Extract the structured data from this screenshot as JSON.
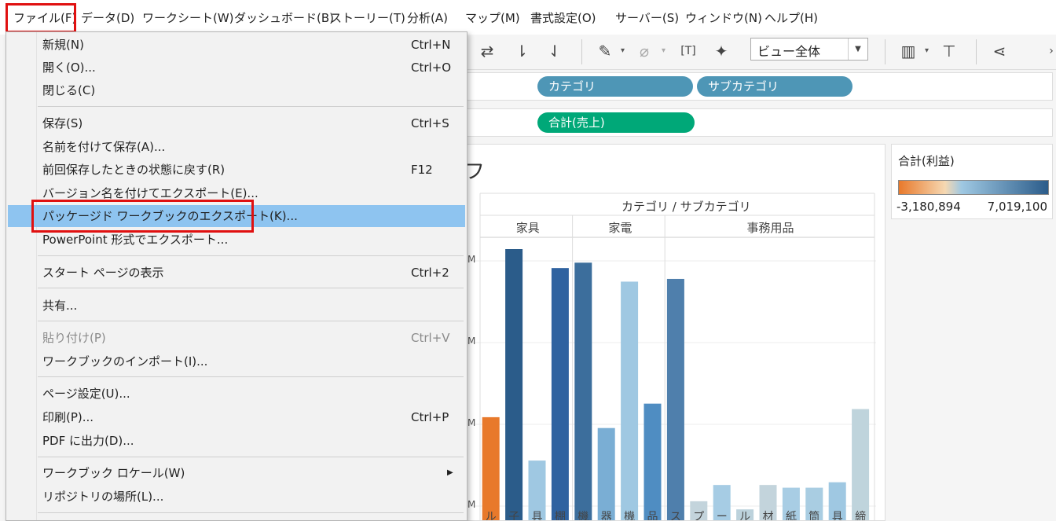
{
  "menubar": {
    "items": [
      {
        "label": "ファイル(F)",
        "name": "menu-file"
      },
      {
        "label": "データ(D)",
        "name": "menu-data"
      },
      {
        "label": "ワークシート(W)",
        "name": "menu-worksheet"
      },
      {
        "label": "ダッシュボード(B)",
        "name": "menu-dashboard"
      },
      {
        "label": "ストーリー(T)",
        "name": "menu-story"
      },
      {
        "label": "分析(A)",
        "name": "menu-analysis"
      },
      {
        "label": "マップ(M)",
        "name": "menu-map"
      },
      {
        "label": "書式設定(O)",
        "name": "menu-format"
      },
      {
        "label": "サーバー(S)",
        "name": "menu-server"
      },
      {
        "label": "ウィンドウ(N)",
        "name": "menu-window"
      },
      {
        "label": "ヘルプ(H)",
        "name": "menu-help"
      }
    ]
  },
  "toolbar": {
    "view_select": "ビュー全体",
    "icons": [
      "swap-icon",
      "sort-ascending-icon",
      "sort-descending-icon",
      "highlight-pen-icon",
      "paperclip-icon",
      "text-label-icon",
      "pin-icon",
      "show-me-icon",
      "presentation-icon",
      "share-icon",
      "more-chevron-icon"
    ]
  },
  "shelves": {
    "columns": [
      {
        "label": "カテゴリ",
        "color": "#4e96b6"
      },
      {
        "label": "サブカテゴリ",
        "color": "#4e96b6"
      }
    ],
    "rows": [
      {
        "label": "合計(売上)",
        "color": "#00a878"
      }
    ]
  },
  "view": {
    "title_fragment": "フ",
    "header": "カテゴリ / サブカテゴリ"
  },
  "legend": {
    "title": "合計(利益)",
    "min": "-3,180,894",
    "max": "7,019,100",
    "colors": [
      "#e8792b",
      "#f6d8b2",
      "#9fc8e2",
      "#2b5c8a"
    ]
  },
  "chart_data": {
    "type": "bar",
    "categories": [
      "家具",
      "家電",
      "事務用品"
    ],
    "bars": [
      {
        "category": "家具",
        "value": 38,
        "color": "#e8792b",
        "tick": "ル"
      },
      {
        "category": "家具",
        "value": 100,
        "color": "#2b5c8a",
        "tick": "子"
      },
      {
        "category": "家具",
        "value": 22,
        "color": "#9fc8e2",
        "tick": "具"
      },
      {
        "category": "家具",
        "value": 93,
        "color": "#2f62a0",
        "tick": "棚"
      },
      {
        "category": "家電",
        "value": 95,
        "color": "#3c6e9c",
        "tick": "機"
      },
      {
        "category": "家電",
        "value": 34,
        "color": "#7aaed4",
        "tick": "器"
      },
      {
        "category": "家電",
        "value": 88,
        "color": "#9fc8e2",
        "tick": "機"
      },
      {
        "category": "家電",
        "value": 43,
        "color": "#4f8dc2",
        "tick": "品"
      },
      {
        "category": "事務用品",
        "value": 89,
        "color": "#4f7fac",
        "tick": "ス"
      },
      {
        "category": "事務用品",
        "value": 7,
        "color": "#c3d4dc",
        "tick": "プ"
      },
      {
        "category": "事務用品",
        "value": 13,
        "color": "#a6cce4",
        "tick": "ー"
      },
      {
        "category": "事務用品",
        "value": 4,
        "color": "#bcd2dc",
        "tick": "ル"
      },
      {
        "category": "事務用品",
        "value": 13,
        "color": "#c3d4dc",
        "tick": "材"
      },
      {
        "category": "事務用品",
        "value": 12,
        "color": "#a8cde4",
        "tick": "紙"
      },
      {
        "category": "事務用品",
        "value": 12,
        "color": "#a9cde2",
        "tick": "筒"
      },
      {
        "category": "事務用品",
        "value": 14,
        "color": "#9fc8e2",
        "tick": "具"
      },
      {
        "category": "事務用品",
        "value": 41,
        "color": "#bfd4dc",
        "tick": "締"
      }
    ]
  },
  "file_menu": {
    "items": [
      {
        "label": "新規(N)",
        "shortcut": "Ctrl+N"
      },
      {
        "label": "開く(O)...",
        "shortcut": "Ctrl+O"
      },
      {
        "label": "閉じる(C)",
        "shortcut": ""
      },
      {
        "label": "保存(S)",
        "shortcut": "Ctrl+S"
      },
      {
        "label": "名前を付けて保存(A)...",
        "shortcut": ""
      },
      {
        "label": "前回保存したときの状態に戻す(R)",
        "shortcut": "F12"
      },
      {
        "label": "バージョン名を付けてエクスポート(E)...",
        "shortcut": ""
      },
      {
        "label": "パッケージド ワークブックのエクスポート(K)...",
        "shortcut": ""
      },
      {
        "label": "PowerPoint 形式でエクスポート...",
        "shortcut": ""
      },
      {
        "label": "スタート ページの表示",
        "shortcut": "Ctrl+2"
      },
      {
        "label": "共有...",
        "shortcut": ""
      },
      {
        "label": "貼り付け(P)",
        "shortcut": "Ctrl+V"
      },
      {
        "label": "ワークブックのインポート(I)...",
        "shortcut": ""
      },
      {
        "label": "ページ設定(U)...",
        "shortcut": ""
      },
      {
        "label": "印刷(P)...",
        "shortcut": "Ctrl+P"
      },
      {
        "label": "PDF に出力(D)...",
        "shortcut": ""
      },
      {
        "label": "ワークブック ロケール(W)",
        "shortcut": ""
      },
      {
        "label": "リポジトリの場所(L)...",
        "shortcut": ""
      }
    ]
  }
}
